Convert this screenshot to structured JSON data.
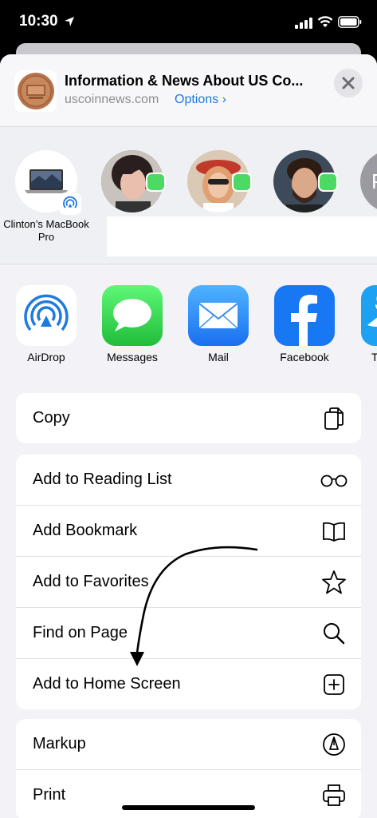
{
  "status_bar": {
    "time": "10:30"
  },
  "header": {
    "title": "Information & News About US Co...",
    "domain": "uscoinnews.com",
    "options_label": "Options ›"
  },
  "contacts": {
    "device_label": "Clinton’s MacBook Pro",
    "partial_initial": "P"
  },
  "apps": [
    {
      "label": "AirDrop"
    },
    {
      "label": "Messages"
    },
    {
      "label": "Mail"
    },
    {
      "label": "Facebook"
    },
    {
      "label": "T"
    }
  ],
  "actions": {
    "copy": "Copy",
    "reading_list": "Add to Reading List",
    "bookmark": "Add Bookmark",
    "favorites": "Add to Favorites",
    "find": "Find on Page",
    "home_screen": "Add to Home Screen",
    "markup": "Markup",
    "print": "Print"
  },
  "colors": {
    "accent": "#1f7ae0",
    "messages_green": "#4cd964",
    "facebook_blue": "#1877f2",
    "airdrop_blue": "#1f7ae0"
  }
}
